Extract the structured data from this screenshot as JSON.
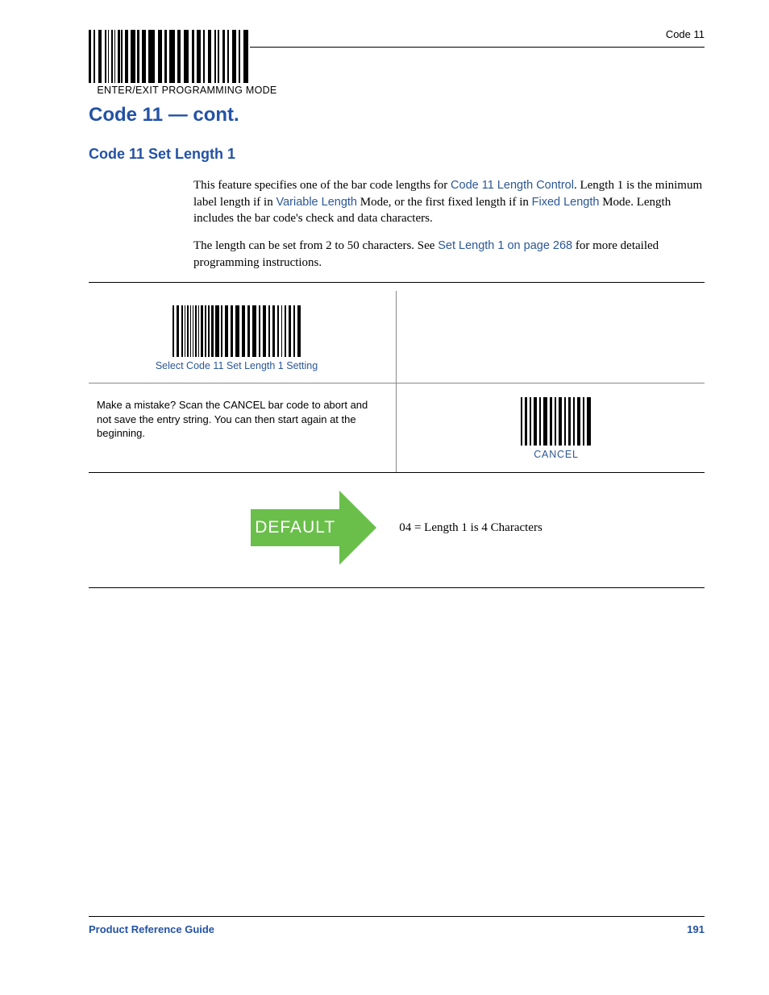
{
  "header": {
    "right_label": "Code 11",
    "barcode_caption": "ENTER/EXIT PROGRAMMING MODE"
  },
  "headings": {
    "h1": "Code 11 — cont.",
    "h2": "Code 11 Set Length 1"
  },
  "paragraph1": {
    "t1": "This feature specifies one of the bar code lengths for ",
    "link1": "Code 11 Length Control",
    "t2": ". Length 1 is the minimum label length if in ",
    "link2": "Variable Length",
    "t3": " Mode, or the first fixed length if in ",
    "link3": "Fixed Length",
    "t4": " Mode. Length includes the bar code's check and data characters."
  },
  "paragraph2": {
    "t1": "The length can be set from 2 to 50 characters. See ",
    "link1": "Set Length 1 on page 268",
    "t2": " for more detailed programming instructions."
  },
  "table": {
    "select_caption": "Select Code 11 Set Length 1 Setting",
    "mistake_text": "Make a mistake? Scan the CANCEL bar code to abort and not save the entry string. You can then start again at the beginning.",
    "cancel_caption": "CANCEL"
  },
  "default": {
    "label": "DEFAULT",
    "value": "04 = Length 1 is 4 Characters"
  },
  "footer": {
    "left": "Product Reference Guide",
    "right": "191"
  }
}
